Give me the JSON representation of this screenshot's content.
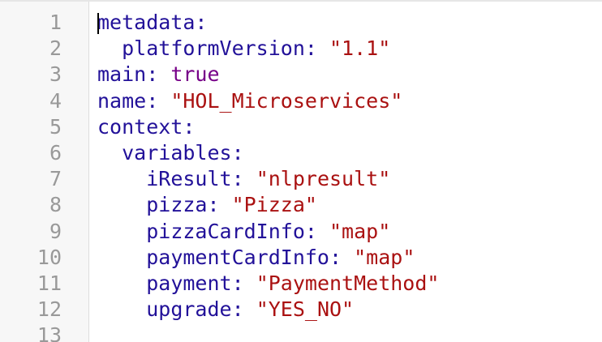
{
  "editor": {
    "line_numbers": [
      "1",
      "2",
      "3",
      "4",
      "5",
      "6",
      "7",
      "8",
      "9",
      "10",
      "11",
      "12",
      "13"
    ],
    "lines": [
      {
        "indent": "",
        "key": "metadata",
        "sep": ":",
        "value": "",
        "value_type": ""
      },
      {
        "indent": "  ",
        "key": "platformVersion",
        "sep": ": ",
        "value": "\"1.1\"",
        "value_type": "str"
      },
      {
        "indent": "",
        "key": "main",
        "sep": ": ",
        "value": "true",
        "value_type": "atom"
      },
      {
        "indent": "",
        "key": "name",
        "sep": ": ",
        "value": "\"HOL_Microservices\"",
        "value_type": "str"
      },
      {
        "indent": "",
        "key": "context",
        "sep": ":",
        "value": "",
        "value_type": ""
      },
      {
        "indent": "  ",
        "key": "variables",
        "sep": ":",
        "value": "",
        "value_type": ""
      },
      {
        "indent": "    ",
        "key": "iResult",
        "sep": ": ",
        "value": "\"nlpresult\"",
        "value_type": "str"
      },
      {
        "indent": "    ",
        "key": "pizza",
        "sep": ": ",
        "value": "\"Pizza\"",
        "value_type": "str"
      },
      {
        "indent": "    ",
        "key": "pizzaCardInfo",
        "sep": ": ",
        "value": "\"map\"",
        "value_type": "str"
      },
      {
        "indent": "    ",
        "key": "paymentCardInfo",
        "sep": ": ",
        "value": "\"map\"",
        "value_type": "str"
      },
      {
        "indent": "    ",
        "key": "payment",
        "sep": ": ",
        "value": "\"PaymentMethod\"",
        "value_type": "str"
      },
      {
        "indent": "    ",
        "key": "upgrade",
        "sep": ": ",
        "value": "\"YES_NO\"",
        "value_type": "str"
      },
      {
        "indent": "",
        "key": "",
        "sep": "",
        "value": "",
        "value_type": ""
      }
    ],
    "colors": {
      "key": "#221199",
      "string": "#aa1111",
      "atom": "#770088",
      "gutter_bg": "#f7f7f7",
      "line_number": "#999999"
    }
  }
}
